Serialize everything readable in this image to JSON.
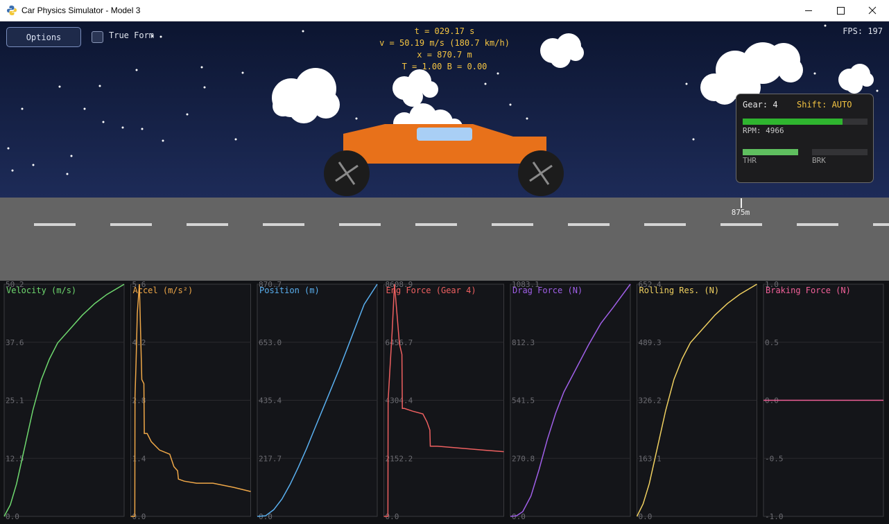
{
  "window": {
    "title": "Car Physics Simulator - Model 3"
  },
  "hud": {
    "time": "t = 029.17 s",
    "velocity": "v = 50.19 m/s  (180.7 km/h)",
    "position": "x = 870.7 m",
    "inputs": "T = 1.00   B = 0.00",
    "fps": "FPS: 197"
  },
  "controls": {
    "options_label": "Options",
    "true_form_label": "True Form",
    "true_form_checked": false
  },
  "gear_panel": {
    "gear": "Gear: 4",
    "shift": "Shift: AUTO",
    "rpm": "RPM: 4966",
    "rpm_fraction": 0.8,
    "thr_label": "THR",
    "brk_label": "BRK",
    "throttle": 1.0,
    "brake": 0.0
  },
  "road": {
    "marker_label": "875m"
  },
  "colors": {
    "car_body": "#e8711a",
    "window": "#a9cff5",
    "hud_text": "#f5c542",
    "gear_value": "#f5c542",
    "rpm_bar": "#2fb52f",
    "thr_bar": "#5fbf5f"
  },
  "chart_data": [
    {
      "type": "line",
      "title": "Velocity (m/s)",
      "color": "#6fd96f",
      "ylim": [
        0.0,
        50.2
      ],
      "ticks": [
        "50.2",
        "37.6",
        "25.1",
        "12.5",
        "0.0"
      ],
      "x": [
        0,
        1.5,
        3,
        5,
        7,
        9,
        11,
        13,
        16,
        19,
        22,
        25,
        29.17
      ],
      "y": [
        0,
        2.5,
        7,
        15,
        23,
        29.5,
        34,
        37.5,
        40.5,
        43.5,
        46,
        48,
        50.19
      ]
    },
    {
      "type": "line",
      "title": "Accel (m/s²)",
      "color": "#f0a848",
      "ylim": [
        0.0,
        5.6
      ],
      "ticks": [
        "5.6",
        "4.2",
        "2.8",
        "1.4",
        "0.0"
      ],
      "x": [
        0,
        0.6,
        1.0,
        1.05,
        1.3,
        1.6,
        2.1,
        2.7,
        3.2,
        3.3,
        4.0,
        5.0,
        7.0,
        9.5,
        10.5,
        11.4,
        11.6,
        13.0,
        16.0,
        20.0,
        25.0,
        29.17
      ],
      "y": [
        0,
        0,
        0,
        2.9,
        3.7,
        4.9,
        5.6,
        3.3,
        3.2,
        2.0,
        2.0,
        1.8,
        1.6,
        1.5,
        1.2,
        1.1,
        0.9,
        0.85,
        0.8,
        0.8,
        0.7,
        0.6
      ]
    },
    {
      "type": "line",
      "title": "Position (m)",
      "color": "#5ab0f0",
      "ylim": [
        0.0,
        870.7
      ],
      "ticks": [
        "870.7",
        "653.0",
        "435.4",
        "217.7",
        "0.0"
      ],
      "x": [
        0,
        2,
        4,
        6,
        8,
        10,
        12,
        14,
        16,
        18,
        20,
        22,
        24,
        26,
        29.17
      ],
      "y": [
        0,
        2,
        25,
        65,
        120,
        185,
        255,
        330,
        405,
        480,
        555,
        635,
        715,
        795,
        870.7
      ]
    },
    {
      "type": "line",
      "title": "Eng Force (Gear 4)",
      "color": "#ee6060",
      "ylim": [
        0.0,
        8608.9
      ],
      "ticks": [
        "8608.9",
        "6456.7",
        "4304.4",
        "2152.2",
        "0.0"
      ],
      "x": [
        0,
        0.6,
        1.0,
        1.05,
        1.5,
        2.0,
        2.6,
        3.2,
        3.8,
        4.4,
        4.5,
        5.0,
        7.0,
        9.5,
        10.5,
        11.2,
        11.3,
        13,
        17,
        21,
        25,
        29.17
      ],
      "y": [
        0,
        0,
        0,
        4300,
        5500,
        6800,
        8608.9,
        7500,
        6400,
        6000,
        4000,
        4000,
        3900,
        3800,
        3500,
        3200,
        2600,
        2600,
        2550,
        2500,
        2450,
        2400
      ]
    },
    {
      "type": "line",
      "title": "Drag Force (N)",
      "color": "#a060e8",
      "ylim": [
        0.0,
        1083.1
      ],
      "ticks": [
        "1083.1",
        "812.3",
        "541.5",
        "270.8",
        "0.0"
      ],
      "x": [
        0,
        1.5,
        3,
        5,
        7,
        9,
        11,
        13,
        16,
        19,
        22,
        25,
        29.17
      ],
      "y": [
        0,
        3,
        22,
        95,
        220,
        360,
        480,
        580,
        690,
        800,
        900,
        975,
        1083.1
      ]
    },
    {
      "type": "line",
      "title": "Rolling Res. (N)",
      "color": "#f0d060",
      "ylim": [
        0.0,
        652.4
      ],
      "ticks": [
        "652.4",
        "489.3",
        "326.2",
        "163.1",
        "0.0"
      ],
      "x": [
        0,
        1.5,
        3,
        5,
        7,
        9,
        11,
        13,
        16,
        19,
        22,
        25,
        29.17
      ],
      "y": [
        0,
        35,
        92,
        195,
        298,
        385,
        443,
        488,
        527,
        566,
        598,
        624,
        652.4
      ]
    },
    {
      "type": "line",
      "title": "Braking Force (N)",
      "color": "#f06098",
      "ylim": [
        -1.0,
        1.0
      ],
      "ticks": [
        "1.0",
        "0.5",
        "0.0",
        "-0.5",
        "-1.0"
      ],
      "x": [
        0,
        29.17
      ],
      "y": [
        0.0,
        0.0
      ]
    }
  ]
}
